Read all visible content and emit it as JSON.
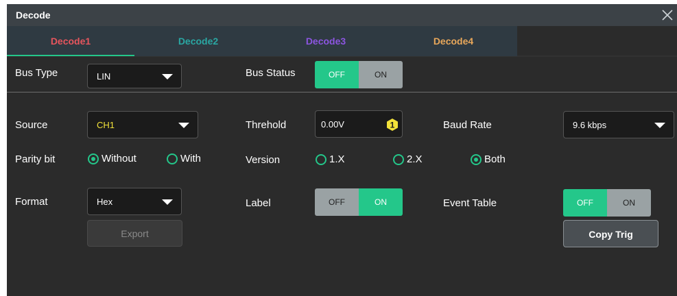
{
  "dialog": {
    "title": "Decode"
  },
  "tabs": [
    {
      "label": "Decode1",
      "color": "#e6555d"
    },
    {
      "label": "Decode2",
      "color": "#2aa7a3"
    },
    {
      "label": "Decode3",
      "color": "#8c55e0"
    },
    {
      "label": "Decode4",
      "color": "#e8a75a"
    }
  ],
  "bus": {
    "type_label": "Bus Type",
    "type_value": "LIN",
    "status_label": "Bus Status",
    "status_off": "OFF",
    "status_on": "ON",
    "status_state": "OFF"
  },
  "source": {
    "label": "Source",
    "value": "CH1",
    "value_color": "#f2e23a"
  },
  "threshold": {
    "label": "Threhold",
    "value": "0.00V",
    "badge": "1"
  },
  "baud": {
    "label": "Baud Rate",
    "value": "9.6  kbps"
  },
  "parity": {
    "label": "Parity bit",
    "options": [
      "Without",
      "With"
    ],
    "selected": "Without"
  },
  "version": {
    "label": "Version",
    "options": [
      "1.X",
      "2.X",
      "Both"
    ],
    "selected": "Both"
  },
  "format": {
    "label": "Format",
    "value": "Hex",
    "export": "Export"
  },
  "label_toggle": {
    "label": "Label",
    "off": "OFF",
    "on": "ON",
    "state": "ON"
  },
  "event_table": {
    "label": "Event Table",
    "off": "OFF",
    "on": "ON",
    "state": "OFF"
  },
  "copy_trig": "Copy Trig",
  "colors": {
    "accent": "#24c78a",
    "inactive": "#9aa2a4",
    "panel": "#2b2b2b"
  }
}
